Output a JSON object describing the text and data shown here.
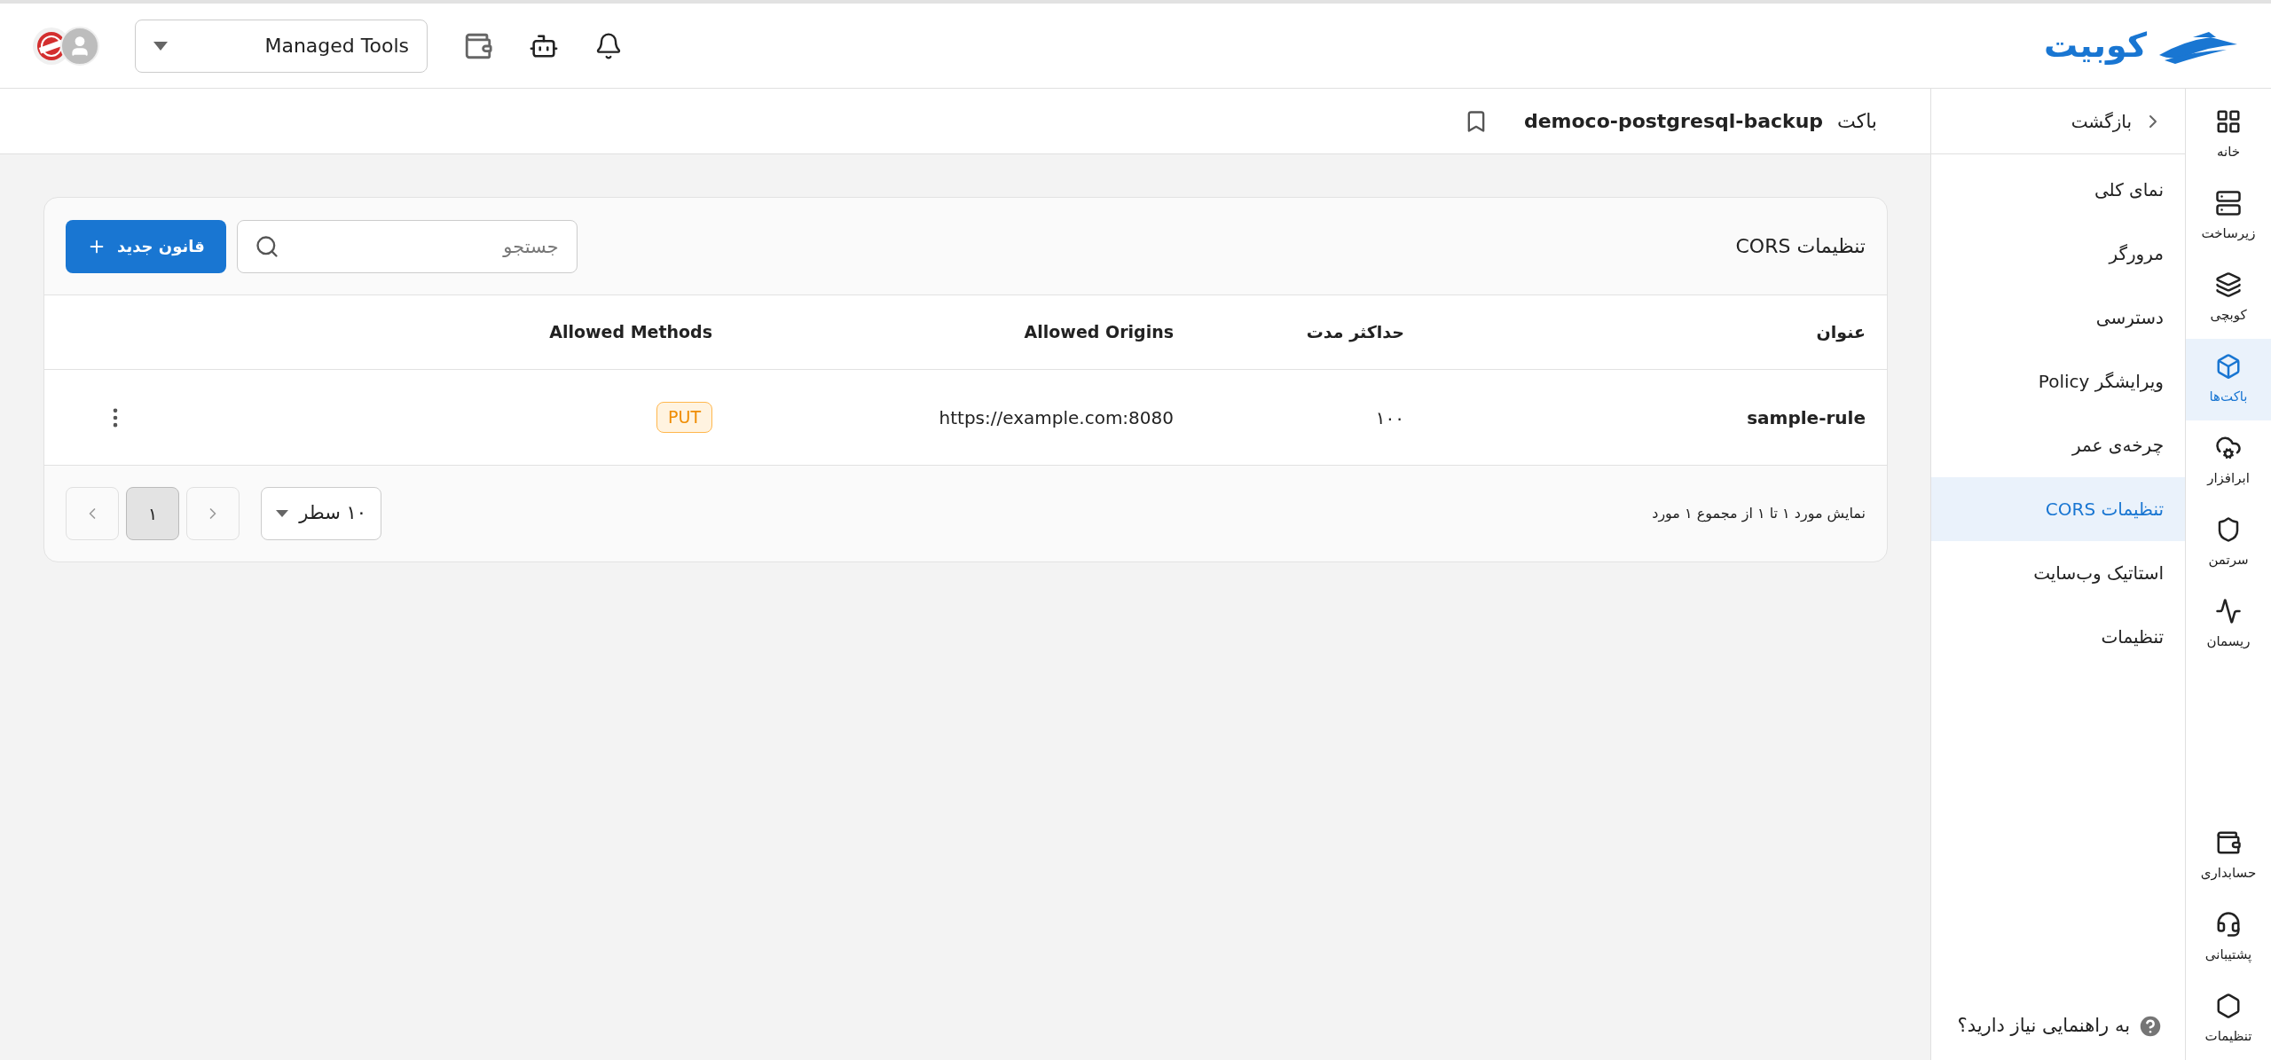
{
  "topbar": {
    "logo": "کوبیت",
    "project_select": {
      "value": "Managed Tools"
    }
  },
  "breadcrumb": {
    "label": "باکت",
    "bucket": "democo-postgresql-backup"
  },
  "rail": {
    "items": [
      {
        "label": "خانه",
        "selected": false
      },
      {
        "label": "زیرساخت",
        "selected": false
      },
      {
        "label": "کوبچی",
        "selected": false
      },
      {
        "label": "باکت‌ها",
        "selected": true
      },
      {
        "label": "ابرافزار",
        "selected": false
      },
      {
        "label": "سرتمن",
        "selected": false
      },
      {
        "label": "ریسمان",
        "selected": false
      }
    ],
    "bottom_items": [
      {
        "label": "حسابداری"
      },
      {
        "label": "پشتیبانی"
      },
      {
        "label": "تنظیمات"
      }
    ]
  },
  "sidebar": {
    "back": "بازگشت",
    "items": [
      {
        "label": "نمای کلی",
        "selected": false
      },
      {
        "label": "مرورگر",
        "selected": false
      },
      {
        "label": "دسترسی",
        "selected": false
      },
      {
        "label": "ویرایشگر Policy",
        "selected": false
      },
      {
        "label": "چرخه‌ی عمر",
        "selected": false
      },
      {
        "label": "تنظیمات CORS",
        "selected": true
      },
      {
        "label": "استاتیک وب‌سایت",
        "selected": false
      },
      {
        "label": "تنظیمات",
        "selected": false
      }
    ],
    "help": "به راهنمایی نیاز دارید؟"
  },
  "card": {
    "title": "تنظیمات CORS",
    "search": {
      "placeholder": "جستجو"
    },
    "new_button": "قانون جدید",
    "table": {
      "columns": [
        "عنوان",
        "حداکثر مدت",
        "Allowed Origins",
        "Allowed Methods"
      ],
      "rows": [
        {
          "title": "sample-rule",
          "max_age": "۱۰۰",
          "origins": "https://example.com:8080",
          "methods": [
            "PUT"
          ]
        }
      ]
    },
    "footer": {
      "summary": "نمایش مورد ۱ تا ۱ از مجموع ۱ مورد",
      "rows_per_page": "۱۰ سطر",
      "pages": [
        {
          "label": "۱",
          "selected": true
        }
      ]
    }
  }
}
